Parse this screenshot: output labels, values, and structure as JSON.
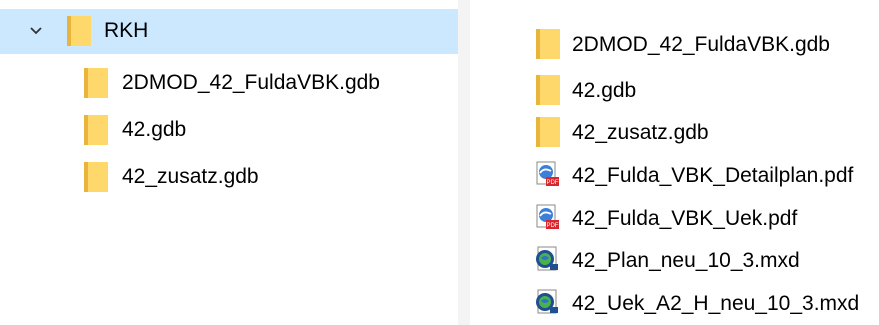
{
  "tree": {
    "root": {
      "label": "RKH",
      "expanded": true,
      "selected": true
    },
    "children": [
      {
        "label": "2DMOD_42_FuldaVBK.gdb"
      },
      {
        "label": "42.gdb"
      },
      {
        "label": "42_zusatz.gdb"
      }
    ]
  },
  "files": [
    {
      "label": "2DMOD_42_FuldaVBK.gdb",
      "icon": "folder-icon"
    },
    {
      "label": "42.gdb",
      "icon": "folder-icon"
    },
    {
      "label": "42_zusatz.gdb",
      "icon": "folder-icon"
    },
    {
      "label": "42_Fulda_VBK_Detailplan.pdf",
      "icon": "pdf-icon"
    },
    {
      "label": "42_Fulda_VBK_Uek.pdf",
      "icon": "pdf-icon"
    },
    {
      "label": "42_Plan_neu_10_3.mxd",
      "icon": "mxd-icon"
    },
    {
      "label": "42_Uek_A2_H_neu_10_3.mxd",
      "icon": "mxd-icon"
    }
  ],
  "colors": {
    "selection": "#cce8ff",
    "folder_body": "#ffd86b",
    "folder_back": "#e9b43c",
    "pdf_red": "#d9252b",
    "mxd_blue": "#1f4f8f",
    "mxd_green": "#4caf50"
  }
}
